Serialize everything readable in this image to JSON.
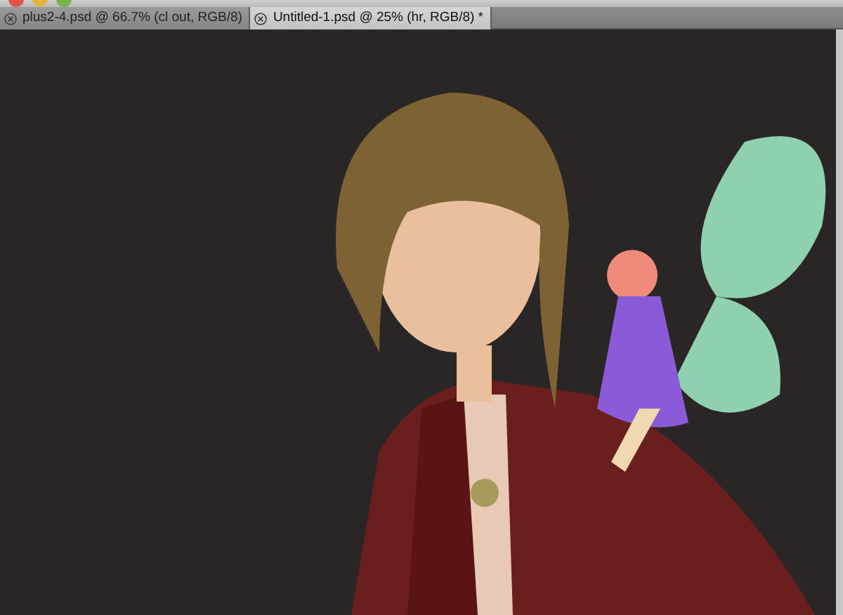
{
  "tabs": [
    {
      "label": "plus2-4.psd @ 66.7% (cl out, RGB/8)",
      "selected": false
    },
    {
      "label": "Untitled-1.psd @ 25% (hr, RGB/8) *",
      "selected": true
    }
  ]
}
